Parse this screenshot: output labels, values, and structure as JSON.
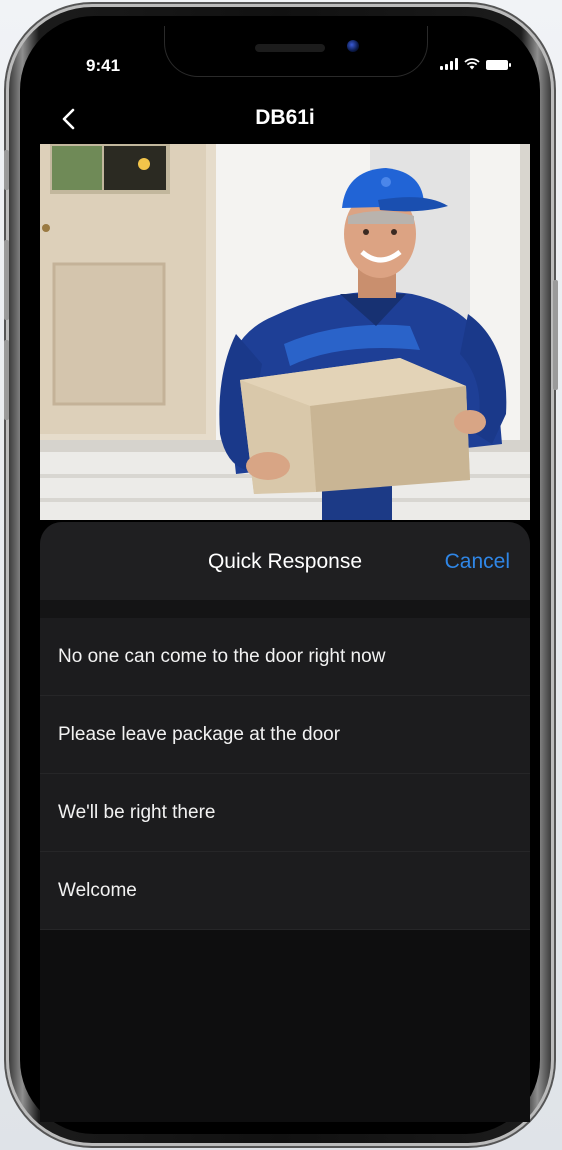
{
  "status_bar": {
    "time": "9:41"
  },
  "navbar": {
    "back_icon": "chevron-left-icon",
    "title": "DB61i"
  },
  "camera_feed": {
    "content": "delivery-person-with-package"
  },
  "quick_response": {
    "title": "Quick Response",
    "cancel_label": "Cancel",
    "items": [
      {
        "label": "No one can come to the door right now"
      },
      {
        "label": "Please leave package at the door"
      },
      {
        "label": "We'll be right there"
      },
      {
        "label": "Welcome"
      }
    ]
  },
  "colors": {
    "accent": "#2f86e6",
    "sheet_background": "#1c1c1e",
    "screen_background": "#000000"
  }
}
